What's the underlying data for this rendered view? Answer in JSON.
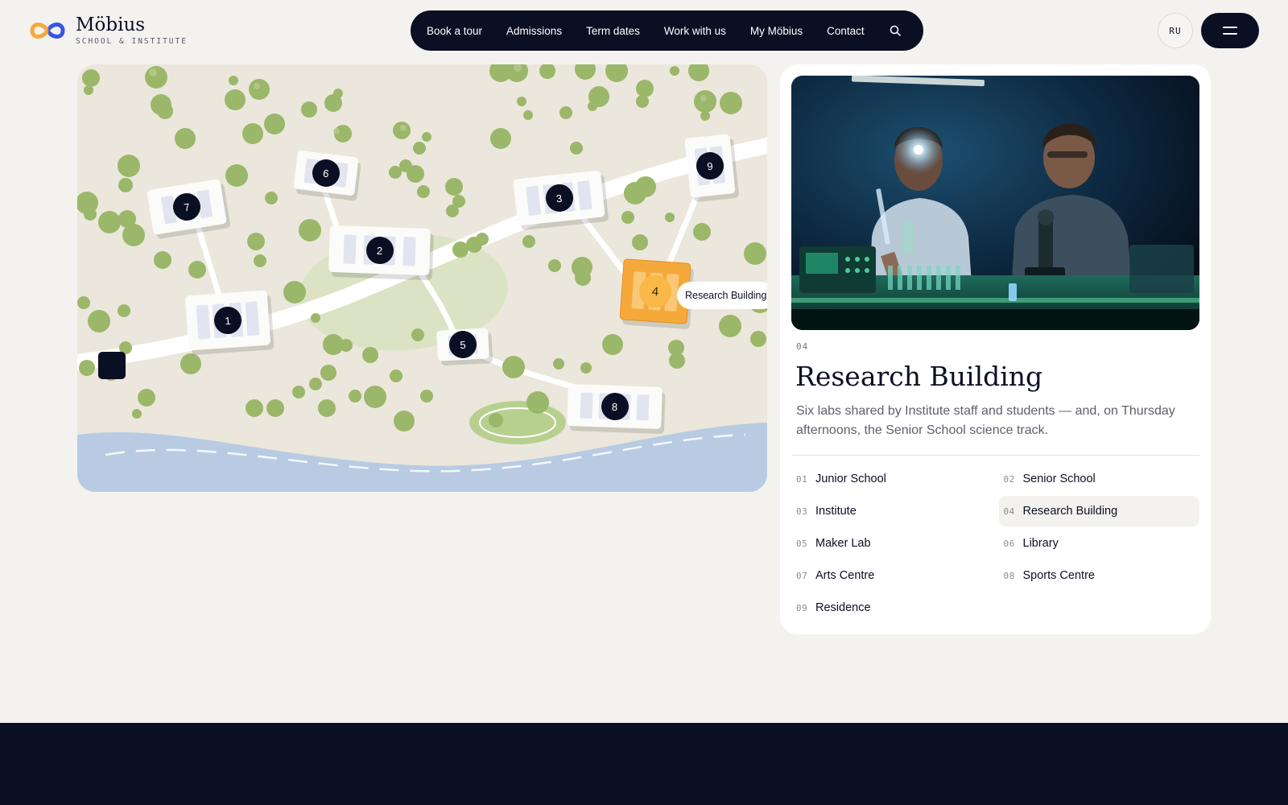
{
  "brand": {
    "name": "Möbius",
    "subtitle": "SCHOOL & INSTITUTE",
    "colors": {
      "navy": "#0b0f24",
      "accent": "#f6a93b",
      "page": "#f3f2ef"
    }
  },
  "nav": {
    "items": [
      {
        "label": "Book a tour"
      },
      {
        "label": "Admissions"
      },
      {
        "label": "Term dates"
      },
      {
        "label": "Work with us"
      },
      {
        "label": "My Möbius"
      },
      {
        "label": "Contact"
      }
    ],
    "search_icon": "search-icon"
  },
  "header": {
    "lang_label": "RU",
    "menu_icon": "hamburger-menu-icon"
  },
  "map": {
    "markers": [
      {
        "num": "1",
        "name": "Junior School"
      },
      {
        "num": "2",
        "name": "Senior School"
      },
      {
        "num": "3",
        "name": "Institute"
      },
      {
        "num": "4",
        "name": "Research Building"
      },
      {
        "num": "5",
        "name": "Maker Lab"
      },
      {
        "num": "6",
        "name": "Library"
      },
      {
        "num": "7",
        "name": "Arts Centre"
      },
      {
        "num": "8",
        "name": "Sports Centre"
      },
      {
        "num": "9",
        "name": "Residence"
      }
    ],
    "active_index": 3,
    "tooltip": "Research Building"
  },
  "detail": {
    "num": "04",
    "title": "Research Building",
    "description": "Six labs shared by Institute staff and students — and, on Thursday afternoons, the Senior School science track."
  },
  "buildings": [
    {
      "num": "01",
      "name": "Junior School"
    },
    {
      "num": "02",
      "name": "Senior School"
    },
    {
      "num": "03",
      "name": "Institute"
    },
    {
      "num": "04",
      "name": "Research Building"
    },
    {
      "num": "05",
      "name": "Maker Lab"
    },
    {
      "num": "06",
      "name": "Library"
    },
    {
      "num": "07",
      "name": "Arts Centre"
    },
    {
      "num": "08",
      "name": "Sports Centre"
    },
    {
      "num": "09",
      "name": "Residence"
    }
  ]
}
